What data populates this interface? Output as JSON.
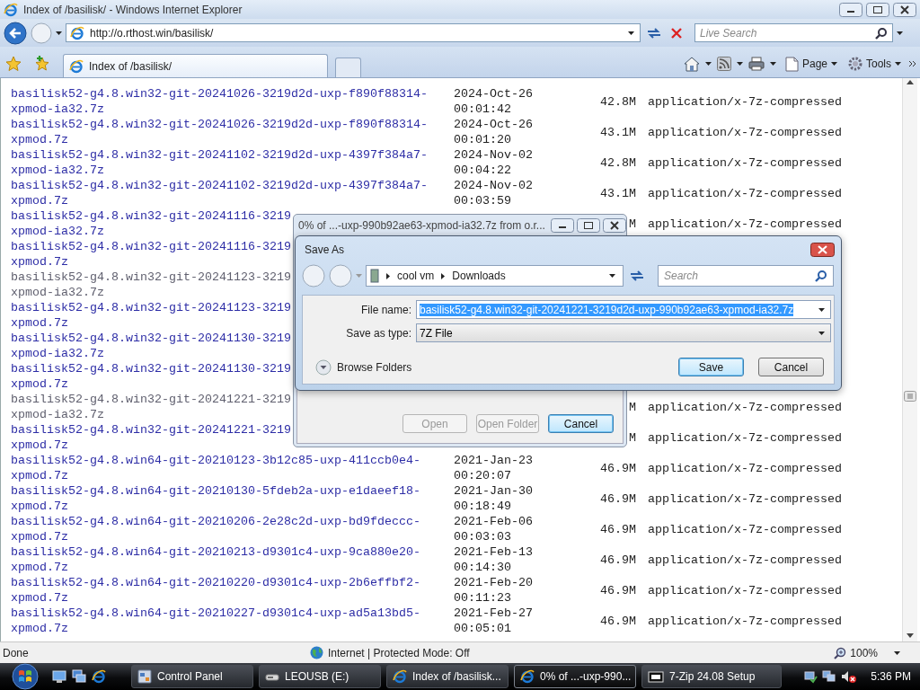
{
  "window": {
    "title": "Index of /basilisk/ - Windows Internet Explorer"
  },
  "nav": {
    "address": "http://o.rthost.win/basilisk/",
    "search_placeholder": "Live Search"
  },
  "toolbar": {
    "tabs": [
      {
        "label": "Index of /basilisk/",
        "selected": true
      }
    ],
    "commands": [
      "Page",
      "Tools"
    ]
  },
  "listing": {
    "rows": [
      {
        "name": [
          "basilisk52-g4.8.win32-git-20241026-3219d2d-uxp-f890f88314-",
          "xpmod-ia32.7z"
        ],
        "visited": false,
        "modified": [
          "2024-Oct-26",
          "00:01:42"
        ],
        "size": "42.8M",
        "type": "application/x-7z-compressed"
      },
      {
        "name": [
          "basilisk52-g4.8.win32-git-20241026-3219d2d-uxp-f890f88314-",
          "xpmod.7z"
        ],
        "visited": false,
        "modified": [
          "2024-Oct-26",
          "00:01:20"
        ],
        "size": "43.1M",
        "type": "application/x-7z-compressed"
      },
      {
        "name": [
          "basilisk52-g4.8.win32-git-20241102-3219d2d-uxp-4397f384a7-",
          "xpmod-ia32.7z"
        ],
        "visited": false,
        "modified": [
          "2024-Nov-02",
          "00:04:22"
        ],
        "size": "42.8M",
        "type": "application/x-7z-compressed"
      },
      {
        "name": [
          "basilisk52-g4.8.win32-git-20241102-3219d2d-uxp-4397f384a7-",
          "xpmod.7z"
        ],
        "visited": false,
        "modified": [
          "2024-Nov-02",
          "00:03:59"
        ],
        "size": "43.1M",
        "type": "application/x-7z-compressed"
      },
      {
        "name": [
          "basilisk52-g4.8.win32-git-20241116-3219",
          "xpmod-ia32.7z"
        ],
        "visited": false,
        "size": "M",
        "type": "application/x-7z-compressed"
      },
      {
        "name": [
          "basilisk52-g4.8.win32-git-20241116-3219",
          "xpmod.7z"
        ],
        "visited": false
      },
      {
        "name": [
          "basilisk52-g4.8.win32-git-20241123-3219",
          "xpmod-ia32.7z"
        ],
        "visited": true
      },
      {
        "name": [
          "basilisk52-g4.8.win32-git-20241123-3219",
          "xpmod.7z"
        ],
        "visited": false
      },
      {
        "name": [
          "basilisk52-g4.8.win32-git-20241130-3219",
          "xpmod-ia32.7z"
        ],
        "visited": false
      },
      {
        "name": [
          "basilisk52-g4.8.win32-git-20241130-3219",
          "xpmod.7z"
        ],
        "visited": false
      },
      {
        "name": [
          "basilisk52-g4.8.win32-git-20241221-3219",
          "xpmod-ia32.7z"
        ],
        "visited": true,
        "size": "M",
        "type": "application/x-7z-compressed"
      },
      {
        "name": [
          "basilisk52-g4.8.win32-git-20241221-3219",
          "xpmod.7z"
        ],
        "visited": false,
        "size": "M",
        "type": "application/x-7z-compressed"
      },
      {
        "name": [
          "basilisk52-g4.8.win64-git-20210123-3b12c85-uxp-411ccb0e4-",
          "xpmod.7z"
        ],
        "visited": false,
        "modified": [
          "2021-Jan-23",
          "00:20:07"
        ],
        "size": "46.9M",
        "type": "application/x-7z-compressed"
      },
      {
        "name": [
          "basilisk52-g4.8.win64-git-20210130-5fdeb2a-uxp-e1daeef18-",
          "xpmod.7z"
        ],
        "visited": false,
        "modified": [
          "2021-Jan-30",
          "00:18:49"
        ],
        "size": "46.9M",
        "type": "application/x-7z-compressed"
      },
      {
        "name": [
          "basilisk52-g4.8.win64-git-20210206-2e28c2d-uxp-bd9fdeccc-",
          "xpmod.7z"
        ],
        "visited": false,
        "modified": [
          "2021-Feb-06",
          "00:03:03"
        ],
        "size": "46.9M",
        "type": "application/x-7z-compressed"
      },
      {
        "name": [
          "basilisk52-g4.8.win64-git-20210213-d9301c4-uxp-9ca880e20-",
          "xpmod.7z"
        ],
        "visited": false,
        "modified": [
          "2021-Feb-13",
          "00:14:30"
        ],
        "size": "46.9M",
        "type": "application/x-7z-compressed"
      },
      {
        "name": [
          "basilisk52-g4.8.win64-git-20210220-d9301c4-uxp-2b6effbf2-",
          "xpmod.7z"
        ],
        "visited": false,
        "modified": [
          "2021-Feb-20",
          "00:11:23"
        ],
        "size": "46.9M",
        "type": "application/x-7z-compressed"
      },
      {
        "name": [
          "basilisk52-g4.8.win64-git-20210227-d9301c4-uxp-ad5a13bd5-",
          "xpmod.7z"
        ],
        "visited": false,
        "modified": [
          "2021-Feb-27",
          "00:05:01"
        ],
        "size": "46.9M",
        "type": "application/x-7z-compressed"
      }
    ]
  },
  "download_window": {
    "title": "0% of ...-uxp-990b92ae63-xpmod-ia32.7z from o.r...",
    "buttons": [
      {
        "label": "Open",
        "disabled": true,
        "focused": false
      },
      {
        "label": "Open Folder",
        "disabled": true,
        "focused": false
      },
      {
        "label": "Cancel",
        "disabled": false,
        "focused": true
      }
    ]
  },
  "save_dialog": {
    "title": "Save As",
    "path": [
      "cool vm",
      "Downloads"
    ],
    "search_placeholder": "Search",
    "file_name_label": "File name:",
    "file_name": "basilisk52-g4.8.win32-git-20241221-3219d2d-uxp-990b92ae63-xpmod-ia32.7z",
    "file_name_selected": true,
    "type_label": "Save as type:",
    "type": "7Z File",
    "browse": "Browse Folders",
    "buttons": [
      {
        "label": "Save",
        "focused": true
      },
      {
        "label": "Cancel",
        "focused": false
      }
    ]
  },
  "status_bar": {
    "text": "Done",
    "zone": "Internet | Protected Mode: Off",
    "zoom": "100%"
  },
  "taskbar": {
    "tasks": [
      {
        "label": "Control Panel",
        "kind": "panel",
        "active": false
      },
      {
        "label": "LEOUSB (E:)",
        "kind": "drive",
        "active": false
      },
      {
        "label": "Index of /basilisk...",
        "kind": "browser",
        "active": false
      },
      {
        "label": "0% of ...-uxp-990...",
        "kind": "browser",
        "active": true
      },
      {
        "label": "7-Zip 24.08 Setup",
        "kind": "archive",
        "active": false
      }
    ],
    "clock": "5:36 PM"
  }
}
